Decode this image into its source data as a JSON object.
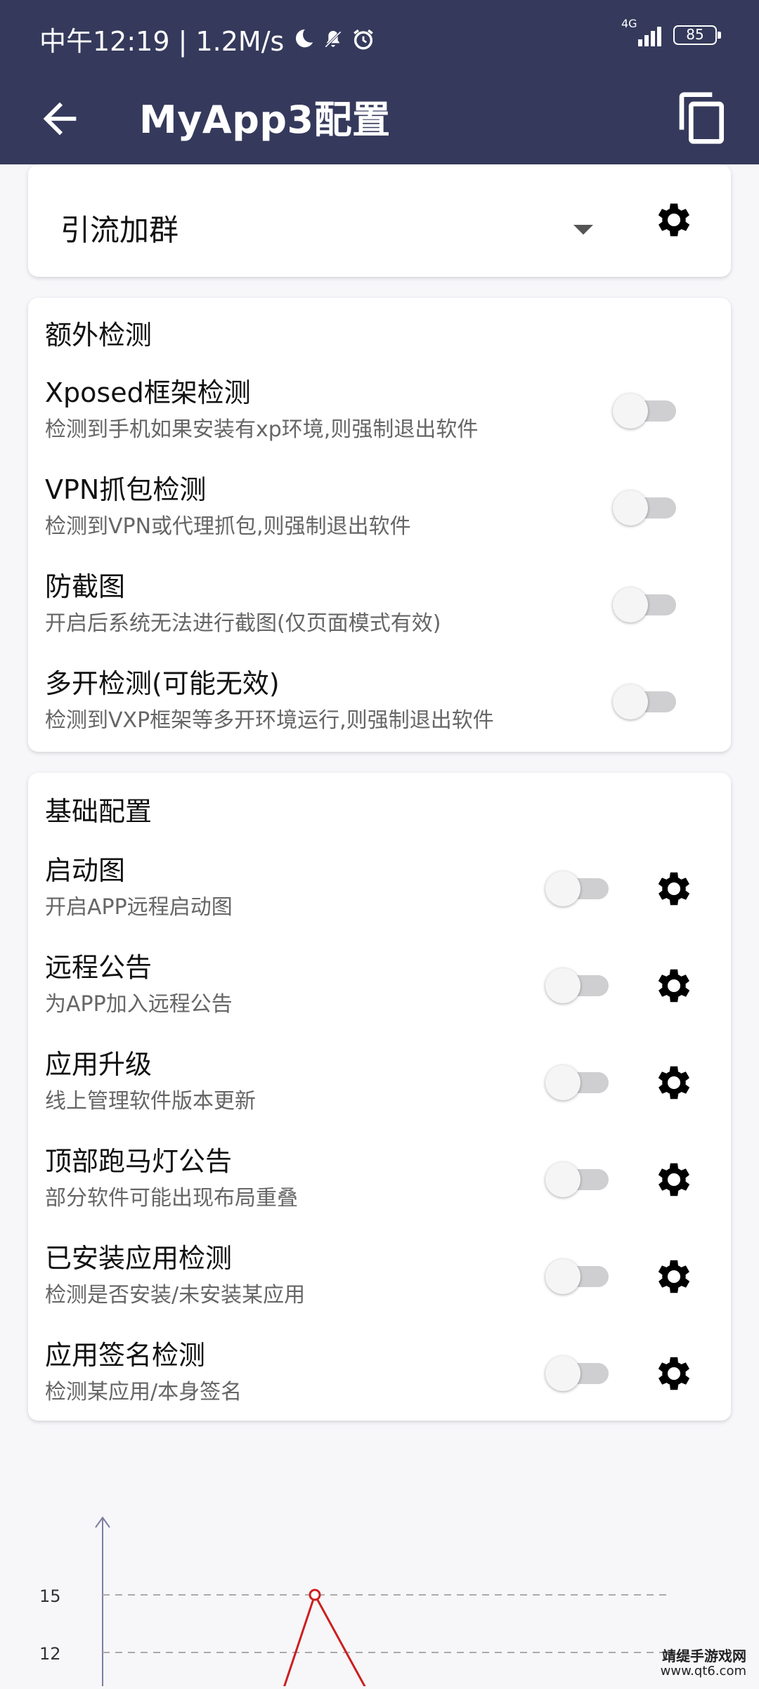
{
  "status": {
    "time_speed": "中午12:19 | 1.2M/s",
    "network": "4G",
    "battery": "85"
  },
  "appbar": {
    "title": "MyApp3配置"
  },
  "dropdown": {
    "selected": "引流加群"
  },
  "extra_section": {
    "title": "额外检测",
    "items": [
      {
        "title": "Xposed框架检测",
        "subtitle": "检测到手机如果安装有xp环境,则强制退出软件",
        "enabled": false
      },
      {
        "title": "VPN抓包检测",
        "subtitle": "检测到VPN或代理抓包,则强制退出软件",
        "enabled": false
      },
      {
        "title": "防截图",
        "subtitle": "开启后系统无法进行截图(仅页面模式有效)",
        "enabled": false
      },
      {
        "title": "多开检测(可能无效)",
        "subtitle": "检测到VXP框架等多开环境运行,则强制退出软件",
        "enabled": false
      }
    ]
  },
  "basic_section": {
    "title": "基础配置",
    "items": [
      {
        "title": "启动图",
        "subtitle": "开启APP远程启动图",
        "enabled": false
      },
      {
        "title": "远程公告",
        "subtitle": "为APP加入远程公告",
        "enabled": false
      },
      {
        "title": "应用升级",
        "subtitle": "线上管理软件版本更新",
        "enabled": false
      },
      {
        "title": "顶部跑马灯公告",
        "subtitle": "部分软件可能出现布局重叠",
        "enabled": false
      },
      {
        "title": "已安装应用检测",
        "subtitle": "检测是否安装/未安装某应用",
        "enabled": false
      },
      {
        "title": "应用签名检测",
        "subtitle": "检测某应用/本身签名",
        "enabled": false
      }
    ]
  },
  "chart_data": {
    "type": "line",
    "y_ticks": [
      "15",
      "12"
    ],
    "grid": "dashed",
    "series": [
      {
        "color": "#cc1f1f",
        "peak_value": 15
      }
    ]
  },
  "watermark": {
    "line1": "靖缇手游戏网",
    "line2": "www.qt6.com"
  }
}
